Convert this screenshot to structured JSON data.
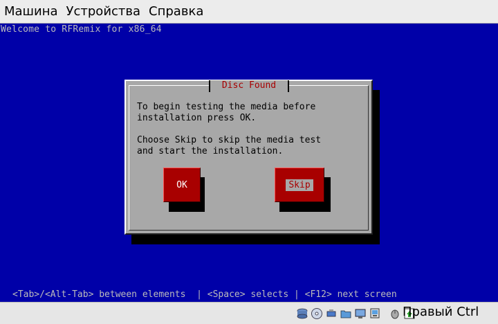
{
  "menubar": {
    "items": [
      "Машина",
      "Устройства",
      "Справка"
    ]
  },
  "screen": {
    "welcome": "Welcome to RFRemix for x86_64",
    "help": "<Tab>/<Alt-Tab> between elements  | <Space> selects | <F12> next screen"
  },
  "dialog": {
    "title": "Disc Found",
    "line1": "To begin testing the media before",
    "line2": "installation press OK.",
    "line3": "Choose Skip to skip the media test",
    "line4": "and start the installation.",
    "ok_label": "OK",
    "skip_label": "Skip"
  },
  "statusbar": {
    "host_key": "Правый Ctrl",
    "icons": [
      "hard-disk-icon",
      "optical-drive-icon",
      "usb-icon",
      "shared-folders-icon",
      "display-icon",
      "network-icon",
      "mouse-integration-icon",
      "host-key-indicator-icon"
    ]
  },
  "colors": {
    "screen_bg": "#0000a8",
    "dialog_bg": "#a8a8a8",
    "button_bg": "#a80000",
    "title_color": "#a80000"
  }
}
